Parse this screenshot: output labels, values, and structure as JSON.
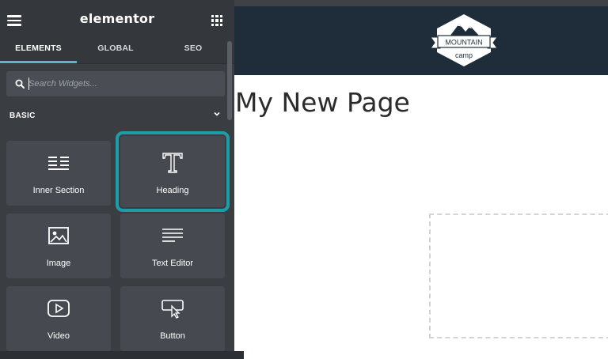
{
  "panel": {
    "brand": "elementor",
    "tabs": [
      {
        "label": "ELEMENTS",
        "active": true
      },
      {
        "label": "GLOBAL",
        "active": false
      },
      {
        "label": "SEO",
        "active": false
      }
    ],
    "search": {
      "placeholder": "Search Widgets...",
      "value": ""
    },
    "section": {
      "title": "BASIC",
      "icon": "chevron-down-icon"
    },
    "widgets": [
      {
        "label": "Inner Section",
        "icon": "inner-section-icon"
      },
      {
        "label": "Heading",
        "icon": "heading-icon",
        "selected": true
      },
      {
        "label": "Image",
        "icon": "image-icon"
      },
      {
        "label": "Text Editor",
        "icon": "text-editor-icon"
      },
      {
        "label": "Video",
        "icon": "video-icon"
      },
      {
        "label": "Button",
        "icon": "button-icon"
      }
    ]
  },
  "preview": {
    "logo": {
      "line1": "MOUNTAIN",
      "line2": "camp"
    },
    "page_title": "My New Page"
  },
  "colors": {
    "panel_bg": "#3a3d42",
    "widget_bg": "#464a50",
    "accent_tab": "#5bb6c7",
    "selection_outline": "#1a9fa8",
    "site_header": "#1f2d3a"
  }
}
